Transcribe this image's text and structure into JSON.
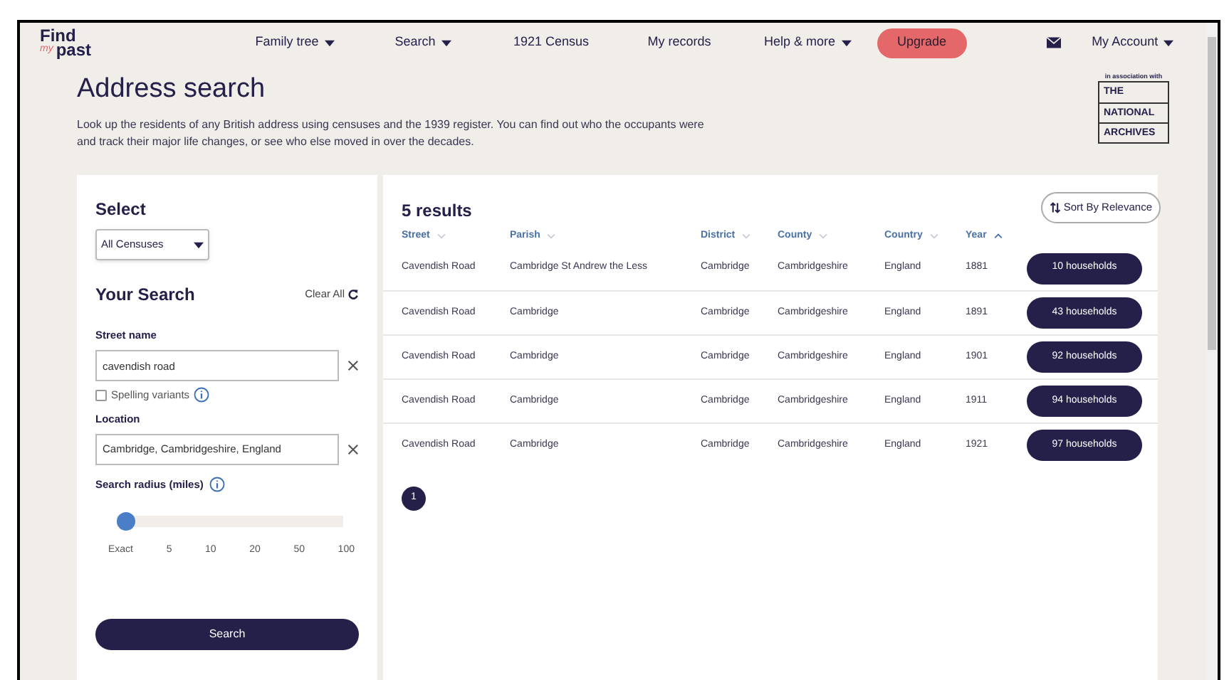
{
  "logo": {
    "line1": "Find",
    "mark": "my",
    "line2": "past"
  },
  "nav": [
    {
      "label": "Family tree",
      "dropdown": true
    },
    {
      "label": "Search",
      "dropdown": true
    },
    {
      "label": "1921 Census",
      "dropdown": false
    },
    {
      "label": "My records",
      "dropdown": false
    },
    {
      "label": "Help & more",
      "dropdown": true
    }
  ],
  "upgrade": "Upgrade",
  "account": "My Account",
  "title": "Address search",
  "intro": "Look up the residents of any British address using censuses and the 1939 register. You can find out who the occupants were and track their major life changes, or see who else moved in over the decades.",
  "partner": {
    "caption": "in association with",
    "lines": [
      "THE",
      "NATIONAL",
      "ARCHIVES"
    ]
  },
  "filters": {
    "select_heading": "Select",
    "census": "All Censuses",
    "your_search": "Your Search",
    "clear_all": "Clear All",
    "street_label": "Street name",
    "street_value": "cavendish road",
    "spelling": {
      "label": "Spelling variants",
      "checked": false
    },
    "location_label": "Location",
    "location_value": "Cambridge, Cambridgeshire, England",
    "radius_label": "Search radius (miles)",
    "radius": {
      "level": 0,
      "ticks": [
        "Exact",
        "5",
        "10",
        "20",
        "50",
        "100"
      ]
    },
    "search_button": "Search"
  },
  "results": {
    "count": "5 results",
    "sort": "Sort By Relevance",
    "columns": [
      {
        "label": "Street",
        "sorted": false
      },
      {
        "label": "Parish",
        "sorted": false
      },
      {
        "label": "District",
        "sorted": false
      },
      {
        "label": "County",
        "sorted": false
      },
      {
        "label": "Country",
        "sorted": false
      },
      {
        "label": "Year",
        "sorted": true
      }
    ],
    "rows": [
      {
        "cells": [
          "Cavendish Road",
          "Cambridge St Andrew the Less",
          "Cambridge",
          "Cambridgeshire",
          "England",
          "1881"
        ],
        "households": "10 households"
      },
      {
        "cells": [
          "Cavendish Road",
          "Cambridge",
          "Cambridge",
          "Cambridgeshire",
          "England",
          "1891"
        ],
        "households": "43 households"
      },
      {
        "cells": [
          "Cavendish Road",
          "Cambridge",
          "Cambridge",
          "Cambridgeshire",
          "England",
          "1901"
        ],
        "households": "92 households"
      },
      {
        "cells": [
          "Cavendish Road",
          "Cambridge",
          "Cambridge",
          "Cambridgeshire",
          "England",
          "1911"
        ],
        "households": "94 households"
      },
      {
        "cells": [
          "Cavendish Road",
          "Cambridge",
          "Cambridge",
          "Cambridgeshire",
          "England",
          "1921"
        ],
        "households": "97 households"
      }
    ],
    "pages": [
      {
        "label": "1",
        "selected": true
      }
    ]
  }
}
